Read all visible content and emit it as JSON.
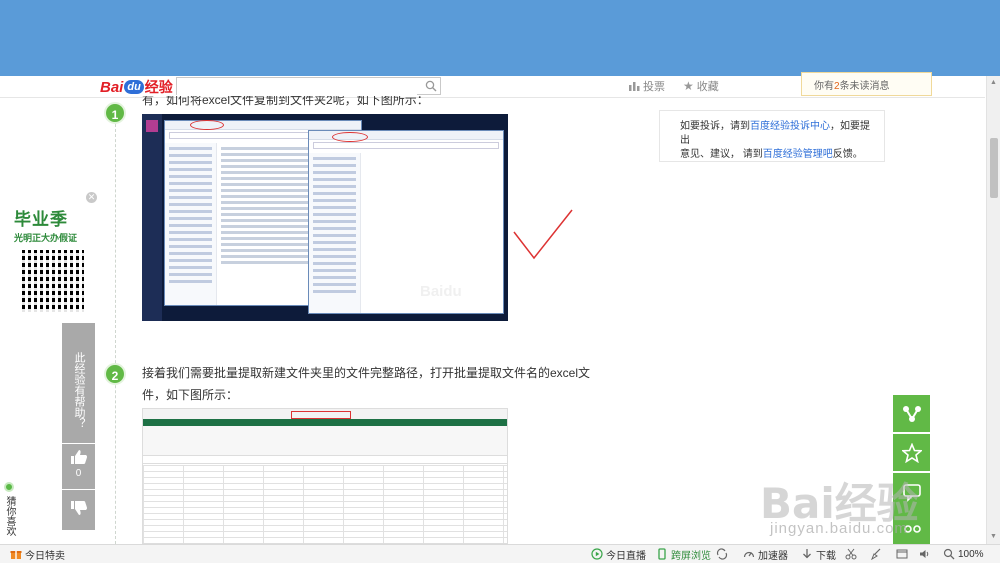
{
  "header": {
    "logo": {
      "bai": "Bai",
      "du": "du",
      "jingyan": "经验"
    },
    "search": {
      "value": ""
    },
    "vote_label": "投票",
    "favorite_label": "收藏",
    "message": {
      "prefix": "你有",
      "count": "2",
      "suffix": "条未读消息"
    }
  },
  "info_panel": {
    "line1_pre": "如要投诉，请到",
    "line1_link": "百度经验投诉中心",
    "line1_post": "，如要提出",
    "line2_pre": "意见、建议， 请到",
    "line2_link": "百度经验管理吧",
    "line2_post": "反馈。"
  },
  "article": {
    "intro_text": "有，如何将excel文件复制到文件夹2呢，如下图所示：",
    "steps": [
      {
        "num": "1"
      },
      {
        "num": "2",
        "text": "接着我们需要批量提取新建文件夹里的文件完整路径，打开批量提取文件名的excel文件，如下图所示："
      }
    ]
  },
  "promo": {
    "title": "毕业季",
    "subtitle": "光明正大办假证",
    "close": "✕"
  },
  "help": {
    "question": "此经验有帮助？",
    "up_count": "0"
  },
  "guess": {
    "label": "猜你喜欢"
  },
  "watermark": {
    "brand": "Bai经验",
    "url": "jingyan.baidu.com",
    "small": "Baidu"
  },
  "statusbar": {
    "left": "今日特卖",
    "live": "今日直播",
    "cross_screen": "跨屏浏览",
    "accelerator": "加速器",
    "download": "下载",
    "zoom": "100%"
  },
  "colors": {
    "accent_green": "#61b946",
    "top_band": "#5a9bd8",
    "link_blue": "#2f6fd8",
    "brand_red": "#e21f26"
  }
}
